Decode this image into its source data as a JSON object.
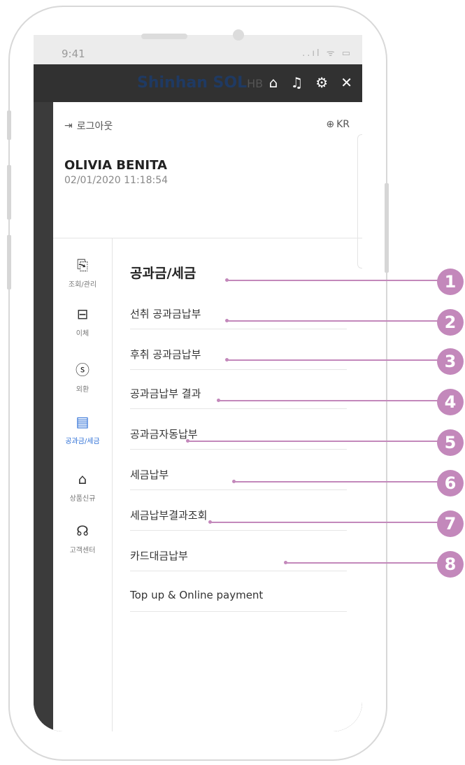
{
  "status_bar": {
    "time": "9:41",
    "signal": "..ıl ᯤ ▭"
  },
  "app_bar": {
    "brand": "Shinhan SOL",
    "brand_suffix": "HB",
    "close": "✕"
  },
  "profile": {
    "logout_label": "로그아웃",
    "language": "KR",
    "user_name": "OLIVIA BENITA",
    "login_datetime": "02/01/2020 11:18:54"
  },
  "left_nav": [
    {
      "label": "조회/관리",
      "icon": "search-document-icon",
      "glyph": "🔍"
    },
    {
      "label": "이체",
      "icon": "transfer-icon",
      "glyph": "⊟"
    },
    {
      "label": "외환",
      "icon": "exchange-icon",
      "glyph": "$"
    },
    {
      "label": "공과금/세금",
      "icon": "bill-icon",
      "glyph": "▤",
      "active": true
    },
    {
      "label": "상품신규",
      "icon": "product-icon",
      "glyph": "⌂"
    },
    {
      "label": "고객센터",
      "icon": "headset-icon",
      "glyph": "☊"
    }
  ],
  "section": {
    "title": "공과금/세금",
    "items": [
      {
        "label": "선취 공과금납부",
        "badge": "1"
      },
      {
        "label": "후취 공과금납부",
        "badge": "2"
      },
      {
        "label": "공과금납부 결과",
        "badge": "3"
      },
      {
        "label": "공과금자동납부",
        "badge": "4"
      },
      {
        "label": "세금납부",
        "badge": "5"
      },
      {
        "label": "세금납부결과조회",
        "badge": "6"
      },
      {
        "label": "카드대금납부",
        "badge": "7"
      },
      {
        "label": "Top up & Online payment",
        "badge": "8"
      }
    ]
  },
  "colors": {
    "callout": "#c388bb",
    "active_nav": "#2d6fd6",
    "app_bar": "#313131"
  }
}
